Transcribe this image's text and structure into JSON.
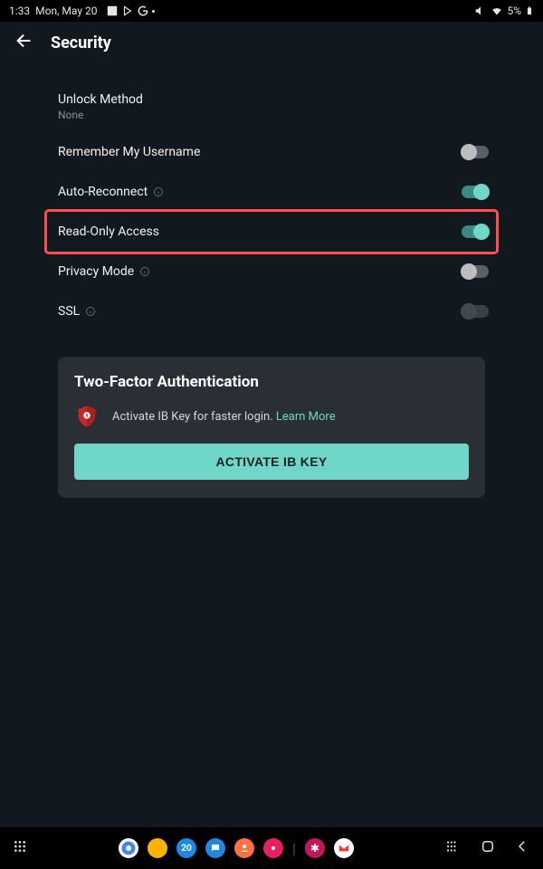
{
  "status": {
    "time": "1:33",
    "date": "Mon, May 20",
    "battery": "5%"
  },
  "header": {
    "title": "Security"
  },
  "rows": {
    "unlock_method": {
      "label": "Unlock Method",
      "value": "None"
    },
    "remember_username": {
      "label": "Remember My Username"
    },
    "auto_reconnect": {
      "label": "Auto-Reconnect"
    },
    "read_only": {
      "label": "Read-Only Access"
    },
    "privacy_mode": {
      "label": "Privacy Mode"
    },
    "ssl": {
      "label": "SSL"
    }
  },
  "toggles": {
    "remember_username": false,
    "auto_reconnect": true,
    "read_only": true,
    "privacy_mode": false,
    "ssl": false
  },
  "two_factor": {
    "title": "Two-Factor Authentication",
    "desc": "Activate IB Key for faster login. ",
    "learn_more": "Learn More",
    "button": "ACTIVATE IB KEY"
  }
}
